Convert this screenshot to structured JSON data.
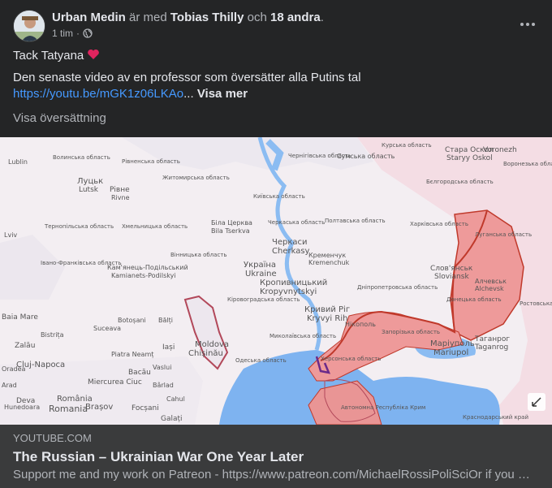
{
  "post": {
    "author": "Urban Medin",
    "with_text": "är med",
    "tagged": "Tobias Thilly",
    "and_text": "och",
    "others": "18 andra",
    "period": ".",
    "time": "1 tim",
    "time_sep": "·",
    "privacy_icon": "globe-icon",
    "line1": "Tack Tatyana",
    "heart": "❤️",
    "line2": "Den senaste video av en professor som översätter alla Putins tal",
    "url": "https://youtu.be/mGK1z06LKAo",
    "ellipsis": "...",
    "see_more": "Visa mer",
    "translate": "Visa översättning"
  },
  "link_preview": {
    "domain": "YOUTUBE.COM",
    "title": "The Russian – Ukrainian War One Year Later",
    "description": "Support me and my work on Patreon - https://www.patreon.com/MichaelRossiPoliSciOr if you want to support me financially with a one time donation"
  },
  "map": {
    "labels": [
      {
        "text": "Луцьк",
        "id": "lutsk-cyr"
      },
      {
        "text": "Lutsk",
        "id": "lutsk"
      },
      {
        "text": "Рівне",
        "id": "rivne-cyr"
      },
      {
        "text": "Rivne",
        "id": "rivne"
      },
      {
        "text": "Черкаси",
        "id": "cherkasy-cyr"
      },
      {
        "text": "Cherkasy",
        "id": "cherkasy"
      },
      {
        "text": "Україна",
        "id": "ukraine-cyr"
      },
      {
        "text": "Ukraine",
        "id": "ukraine"
      },
      {
        "text": "Кропивницький",
        "id": "kropyvnytskyi-cyr"
      },
      {
        "text": "Kropyvnytskyi",
        "id": "kropyvnytskyi"
      },
      {
        "text": "Кременчук",
        "id": "kremenchuk-cyr"
      },
      {
        "text": "Kremenchuk",
        "id": "kremenchuk"
      },
      {
        "text": "Кривий Ріг",
        "id": "kryvyi-rih-cyr"
      },
      {
        "text": "Kryvyi Rih",
        "id": "kryvyi-rih"
      },
      {
        "text": "Нікополь",
        "id": "nikopol-cyr"
      },
      {
        "text": "Маріуполь",
        "id": "mariupol-cyr"
      },
      {
        "text": "Mariupol",
        "id": "mariupol"
      },
      {
        "text": "Таганрог",
        "id": "taganrog-cyr"
      },
      {
        "text": "Taganrog",
        "id": "taganrog"
      },
      {
        "text": "Слов'янськ",
        "id": "sloviansk-cyr"
      },
      {
        "text": "Sloviansk",
        "id": "sloviansk"
      },
      {
        "text": "Алчевськ",
        "id": "alchevsk-cyr"
      },
      {
        "text": "Alchevsk",
        "id": "alchevsk"
      },
      {
        "text": "Біла Церква",
        "id": "bila-cyr"
      },
      {
        "text": "Bila Tserkva",
        "id": "bila"
      },
      {
        "text": "Кам'янець-Подільський",
        "id": "kamianets-cyr"
      },
      {
        "text": "Kamianets-Podilskyi",
        "id": "kamianets"
      },
      {
        "text": "Moldova",
        "id": "moldova"
      },
      {
        "text": "Chișinău",
        "id": "chisinau"
      },
      {
        "text": "Cluj-Napoca",
        "id": "cluj"
      },
      {
        "text": "Romania",
        "id": "romania"
      },
      {
        "text": "România",
        "id": "romania-ro"
      },
      {
        "text": "Brașov",
        "id": "brasov"
      },
      {
        "text": "Bacău",
        "id": "bacau"
      },
      {
        "text": "Galați",
        "id": "galati"
      },
      {
        "text": "Focșani",
        "id": "focsani"
      },
      {
        "text": "Baia Mare",
        "id": "baia-mare"
      },
      {
        "text": "Botoșani",
        "id": "botosani"
      },
      {
        "text": "Bălți",
        "id": "balti"
      },
      {
        "text": "Iași",
        "id": "iasi"
      },
      {
        "text": "Piatra Neamț",
        "id": "piatra"
      },
      {
        "text": "Vaslui",
        "id": "vaslui"
      },
      {
        "text": "Miercurea Ciuc",
        "id": "miercurea"
      },
      {
        "text": "Bârlad",
        "id": "barlad"
      },
      {
        "text": "Cahul",
        "id": "cahul"
      },
      {
        "text": "Deva",
        "id": "deva"
      },
      {
        "text": "Hunedoara",
        "id": "hunedoara"
      },
      {
        "text": "Zalău",
        "id": "zalau"
      },
      {
        "text": "Bistrița",
        "id": "bistrita"
      },
      {
        "text": "Suceava",
        "id": "suceava"
      },
      {
        "text": "Oradea",
        "id": "oradea"
      },
      {
        "text": "Arad",
        "id": "arad"
      },
      {
        "text": "Стара Оскол",
        "id": "oskol-cyr"
      },
      {
        "text": "Staryy Oskol",
        "id": "oskol"
      },
      {
        "text": "Voronezh",
        "id": "voronezh"
      },
      {
        "text": "Сумська область",
        "id": "sumy-cyr"
      },
      {
        "text": "Київська область",
        "id": "kyiv-obl-cyr"
      },
      {
        "text": "Полтавська область",
        "id": "poltava-cyr"
      },
      {
        "text": "Харківська область",
        "id": "kharkiv-cyr"
      },
      {
        "text": "Дніпропетровська область",
        "id": "dnipro-cyr"
      },
      {
        "text": "Запорізька область",
        "id": "zap-cyr"
      },
      {
        "text": "Херсонська область",
        "id": "kherson-cyr"
      },
      {
        "text": "Луганська область",
        "id": "luhansk-cyr"
      },
      {
        "text": "Донецька область",
        "id": "donetsk-cyr"
      },
      {
        "text": "Миколаївська область",
        "id": "mykolaiv-cyr"
      },
      {
        "text": "Одеська область",
        "id": "odesa-cyr"
      },
      {
        "text": "Ростовська область",
        "id": "rostov-cyr"
      },
      {
        "text": "Автономна Республіка Крим",
        "id": "crimea-cyr"
      },
      {
        "text": "Краснодарський край",
        "id": "krasnodar-cyr"
      },
      {
        "text": "Волинська область",
        "id": "volyn-cyr"
      },
      {
        "text": "Рівненська область",
        "id": "rivne-obl-cyr"
      },
      {
        "text": "Житомирська область",
        "id": "zhytomyr-cyr"
      },
      {
        "text": "Хмельницька область",
        "id": "khmelnytskyi-cyr"
      },
      {
        "text": "Вінницька область",
        "id": "vinnytsia-cyr"
      },
      {
        "text": "Черкаська область",
        "id": "cherkasy-obl-cyr"
      },
      {
        "text": "Кіровоградська область",
        "id": "kirovohrad-cyr"
      },
      {
        "text": "Чернігівська область",
        "id": "chernihiv-cyr"
      },
      {
        "text": "Тернопільська область",
        "id": "ternopil-cyr"
      },
      {
        "text": "Івано-Франківська область",
        "id": "ivano-cyr"
      },
      {
        "text": "Бєлгородська область",
        "id": "belgorod-cyr"
      },
      {
        "text": "Воронезька область",
        "id": "voronezh-obl-cyr"
      },
      {
        "text": "Курська область",
        "id": "kursk-cyr"
      },
      {
        "text": "Lublin",
        "id": "lublin"
      },
      {
        "text": "Lviv",
        "id": "lviv"
      }
    ]
  },
  "colors": {
    "bg": "#242526",
    "footer": "#3a3b3c",
    "link": "#4599ff",
    "occupied": "#ee9a9a",
    "occupied_border": "#c0392b",
    "sea": "#7eb3f0"
  }
}
